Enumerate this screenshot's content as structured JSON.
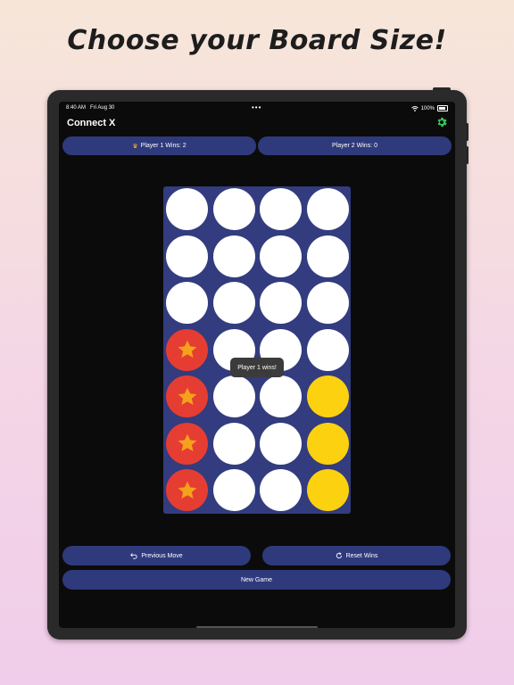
{
  "headline": "Choose your Board Size!",
  "status_bar": {
    "time": "8:40 AM",
    "date": "Fri Aug 30",
    "battery": "100%"
  },
  "app": {
    "title": "Connect X"
  },
  "scores": {
    "player1": "Player 1 Wins: 2",
    "player2": "Player 2 Wins: 0"
  },
  "board": {
    "columns": 4,
    "rows": 7,
    "cells": [
      [
        "empty",
        "empty",
        "empty",
        "empty"
      ],
      [
        "empty",
        "empty",
        "empty",
        "empty"
      ],
      [
        "empty",
        "empty",
        "empty",
        "empty"
      ],
      [
        "red",
        "empty",
        "empty",
        "empty"
      ],
      [
        "red",
        "empty",
        "empty",
        "yellow"
      ],
      [
        "red",
        "empty",
        "empty",
        "yellow"
      ],
      [
        "red",
        "empty",
        "empty",
        "yellow"
      ]
    ],
    "winning_marker": "star-icon"
  },
  "toast": "Player 1 wins!",
  "buttons": {
    "previous_move": "Previous Move",
    "reset_wins": "Reset Wins",
    "new_game": "New Game"
  },
  "colors": {
    "accent_button": "#2f3a7c",
    "board": "#323c7e",
    "player1": "#e63d33",
    "player2": "#fcd10f",
    "star": "#f4a21b",
    "settings_icon": "#33c759"
  }
}
